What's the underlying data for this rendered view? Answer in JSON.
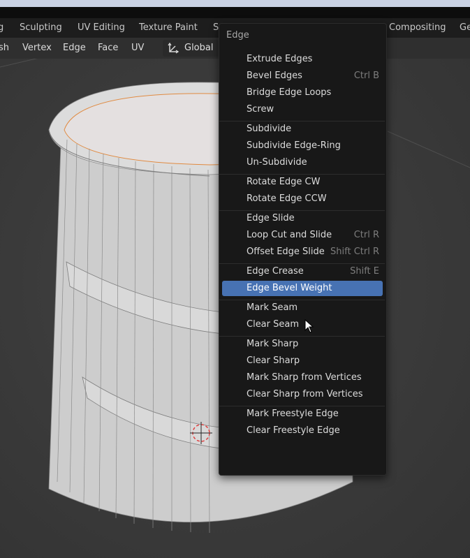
{
  "workspace_tabs": [
    "g",
    "Sculpting",
    "UV Editing",
    "Texture Paint",
    "S",
    "Compositing",
    "Ge"
  ],
  "header_menus": [
    "sh",
    "Vertex",
    "Edge",
    "Face",
    "UV"
  ],
  "transform_orientation": "Global",
  "edge_menu": {
    "title": "Edge",
    "highlighted_item": "Edge Bevel Weight",
    "groups": [
      [
        {
          "label": "Extrude Edges",
          "shortcut": ""
        },
        {
          "label": "Bevel Edges",
          "shortcut": "Ctrl B"
        },
        {
          "label": "Bridge Edge Loops",
          "shortcut": ""
        },
        {
          "label": "Screw",
          "shortcut": ""
        }
      ],
      [
        {
          "label": "Subdivide",
          "shortcut": ""
        },
        {
          "label": "Subdivide Edge-Ring",
          "shortcut": ""
        },
        {
          "label": "Un-Subdivide",
          "shortcut": ""
        }
      ],
      [
        {
          "label": "Rotate Edge CW",
          "shortcut": ""
        },
        {
          "label": "Rotate Edge CCW",
          "shortcut": ""
        }
      ],
      [
        {
          "label": "Edge Slide",
          "shortcut": ""
        },
        {
          "label": "Loop Cut and Slide",
          "shortcut": "Ctrl R"
        },
        {
          "label": "Offset Edge Slide",
          "shortcut": "Shift Ctrl R"
        }
      ],
      [
        {
          "label": "Edge Crease",
          "shortcut": "Shift E"
        },
        {
          "label": "Edge Bevel Weight",
          "shortcut": ""
        }
      ],
      [
        {
          "label": "Mark Seam",
          "shortcut": ""
        },
        {
          "label": "Clear Seam",
          "shortcut": ""
        }
      ],
      [
        {
          "label": "Mark Sharp",
          "shortcut": ""
        },
        {
          "label": "Clear Sharp",
          "shortcut": ""
        },
        {
          "label": "Mark Sharp from Vertices",
          "shortcut": ""
        },
        {
          "label": "Clear Sharp from Vertices",
          "shortcut": ""
        }
      ],
      [
        {
          "label": "Mark Freestyle Edge",
          "shortcut": ""
        },
        {
          "label": "Clear Freestyle Edge",
          "shortcut": ""
        }
      ]
    ]
  },
  "colors": {
    "highlight": "#4772b3",
    "menu_bg": "#181818",
    "mesh": "#d4d4d4",
    "selection_edge": "#e08a40"
  },
  "icons": [
    "transform-orientation-icon",
    "3d-cursor-icon",
    "mouse-pointer-icon"
  ]
}
